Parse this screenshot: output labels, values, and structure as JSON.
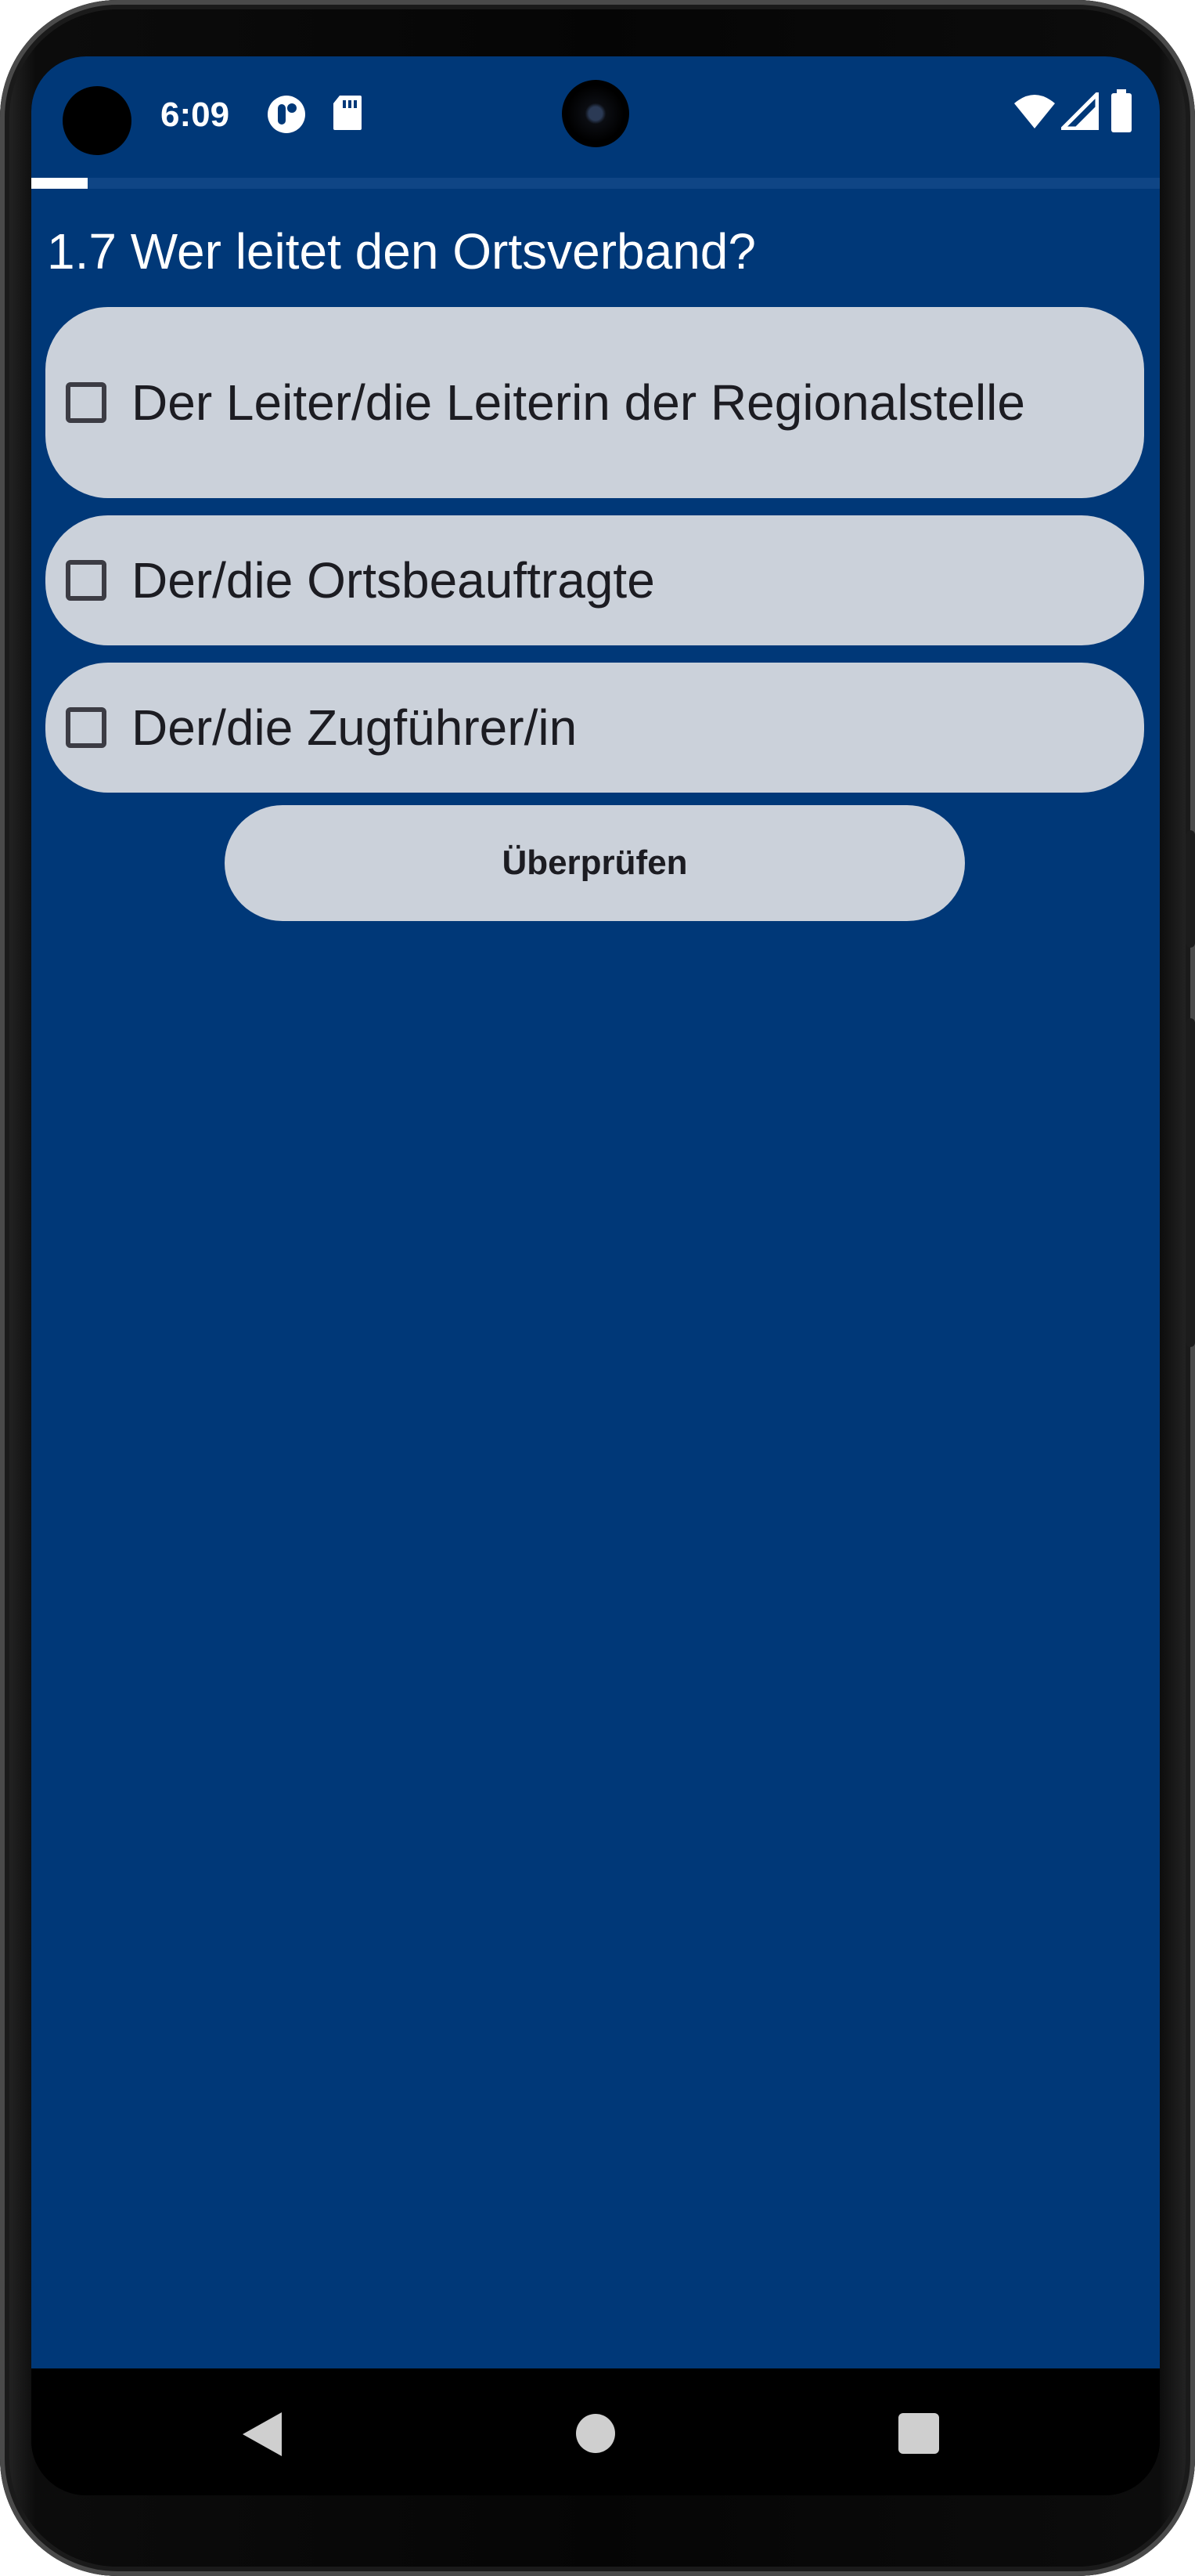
{
  "status_bar": {
    "time": "6:09",
    "icons": [
      "camera-cutout-icon",
      "app-notification-icon",
      "sd-card-icon",
      "wifi-icon",
      "cell-signal-icon",
      "battery-icon"
    ]
  },
  "quiz": {
    "progress_fraction": 0.05,
    "question": "1.7 Wer leitet den Ortsverband?",
    "options": [
      {
        "label": "Der Leiter/die Leiterin der Regionalstelle",
        "checked": false
      },
      {
        "label": "Der/die Ortsbeauftragte",
        "checked": false
      },
      {
        "label": "Der/die Zugführer/in",
        "checked": false
      }
    ],
    "check_button_label": "Überprüfen"
  },
  "nav_bar": {
    "icons": [
      "back-icon",
      "home-icon",
      "recents-icon"
    ]
  },
  "colors": {
    "background": "#003878",
    "option_background": "#cbd1da",
    "text_light": "#ffffff",
    "text_dark": "#1c1c22"
  }
}
